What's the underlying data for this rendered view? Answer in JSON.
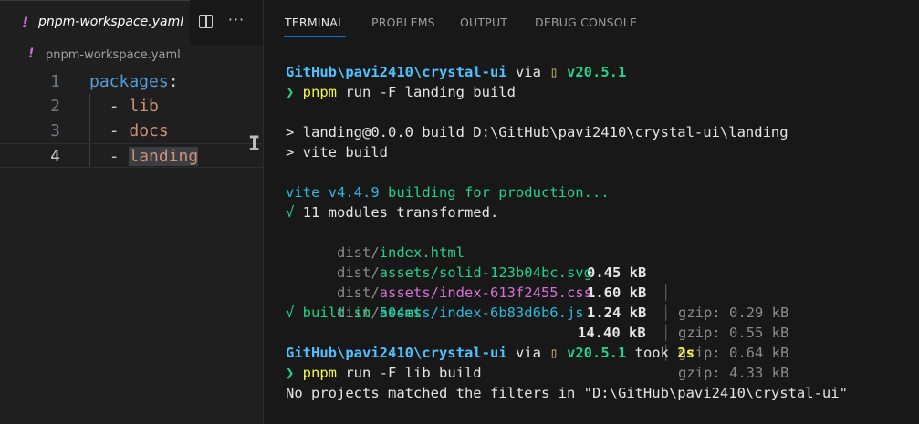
{
  "editor": {
    "tab": {
      "icon": "yaml-exclamation-icon",
      "icon_glyph": "!",
      "title": "pnpm-workspace.yaml"
    },
    "actions": {
      "split": "split-editor-icon",
      "more": "···"
    },
    "breadcrumb": {
      "icon_glyph": "!",
      "file": "pnpm-workspace.yaml"
    },
    "lines": [
      {
        "number": "1",
        "key": "packages",
        "punc": ":"
      },
      {
        "number": "2",
        "dash": "- ",
        "value": "lib"
      },
      {
        "number": "3",
        "dash": "- ",
        "value": "docs"
      },
      {
        "number": "4",
        "dash": "- ",
        "value": "landing"
      }
    ],
    "cursor_glyph": "I"
  },
  "panel": {
    "tabs": [
      "TERMINAL",
      "PROBLEMS",
      "OUTPUT",
      "DEBUG CONSOLE"
    ],
    "active_tab": "TERMINAL"
  },
  "terminal": {
    "prompt1": {
      "path": "GitHub\\pavi2410\\crystal-ui",
      "via": " via ",
      "node_glyph": "▯",
      "version": " v20.5.1"
    },
    "cmd1": {
      "arrow": "❯ ",
      "bin": "pnpm",
      "args": " run -F landing build"
    },
    "build_header1": "> landing@0.0.0 build D:\\GitHub\\pavi2410\\crystal-ui\\landing",
    "build_header2": "> vite build",
    "vite": {
      "name": "vite v4.4.9",
      "rest": " building for production..."
    },
    "transformed": {
      "check": "√",
      "text": " 11 modules transformed."
    },
    "files": [
      {
        "dir": "dist/",
        "name": "index.html",
        "size": "0.45 kB",
        "gzip": "gzip: 0.29 kB",
        "color": "green"
      },
      {
        "dir": "dist/",
        "name": "assets/solid-123b04bc.svg",
        "size": "1.60 kB",
        "gzip": "gzip: 0.55 kB",
        "color": "green"
      },
      {
        "dir": "dist/",
        "name": "assets/index-613f2455.css",
        "size": "1.24 kB",
        "gzip": "gzip: 0.64 kB",
        "color": "magenta"
      },
      {
        "dir": "dist/",
        "name": "assets/index-6b83d6b6.js",
        "size": "14.40 kB",
        "gzip": "gzip: 4.33 kB",
        "color": "cyan"
      }
    ],
    "built": "√ built in 504ms",
    "prompt2": {
      "path": "GitHub\\pavi2410\\crystal-ui",
      "via": " via ",
      "node_glyph": "▯",
      "version": " v20.5.1",
      "took": " took ",
      "duration": "2s"
    },
    "cmd2": {
      "arrow": "❯ ",
      "bin": "pnpm",
      "args": " run -F lib build"
    },
    "error": "No projects matched the filters in \"D:\\GitHub\\pavi2410\\crystal-ui\""
  }
}
